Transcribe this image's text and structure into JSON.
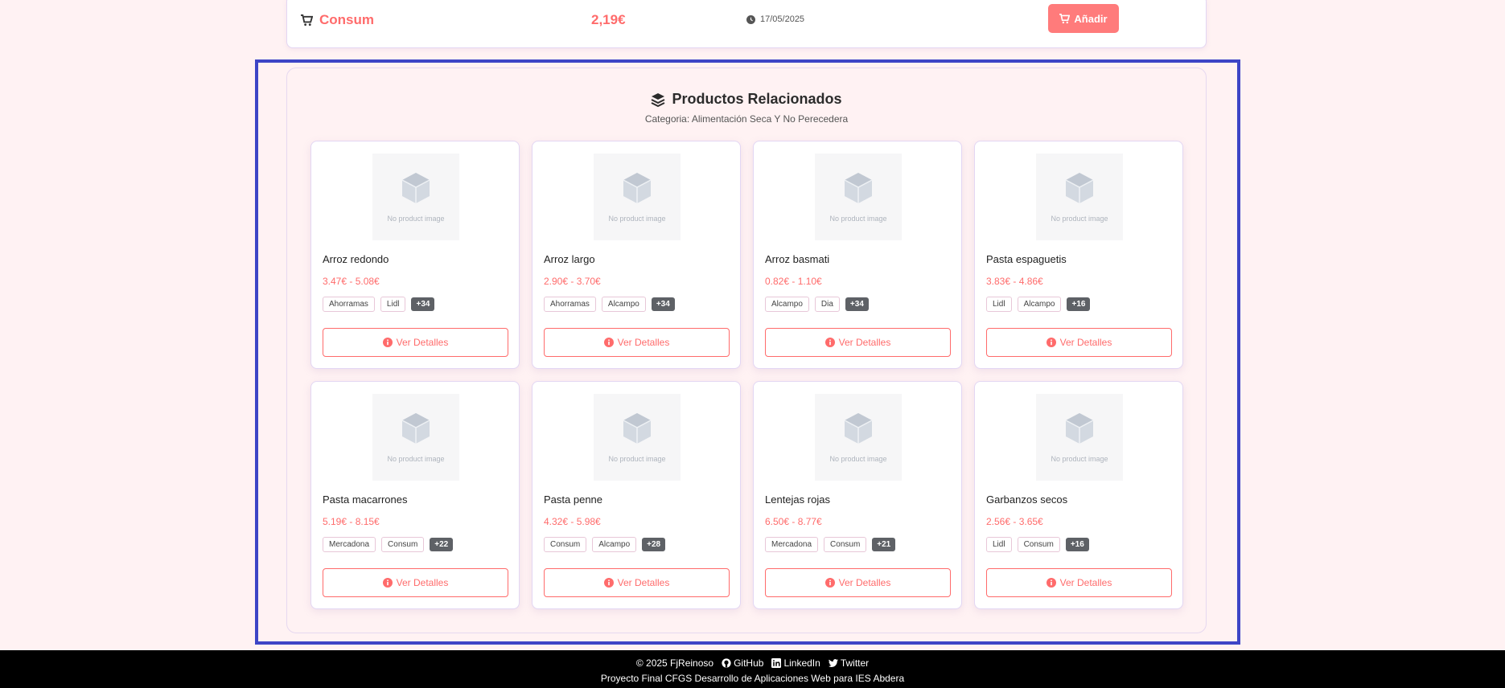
{
  "store_row": {
    "store": "Consum",
    "price": "2,19€",
    "date": "17/05/2025",
    "add_label": "Añadir"
  },
  "related": {
    "title": "Productos Relacionados",
    "subtitle": "Categoria: Alimentación Seca Y No Perecedera",
    "no_image_text": "No product image",
    "detail_label": "Ver Detalles",
    "products": [
      {
        "name": "Arroz redondo",
        "price": "3.47€ - 5.08€",
        "tags": [
          "Ahorramas",
          "Lidl"
        ],
        "more": "+34"
      },
      {
        "name": "Arroz largo",
        "price": "2.90€ - 3.70€",
        "tags": [
          "Ahorramas",
          "Alcampo"
        ],
        "more": "+34"
      },
      {
        "name": "Arroz basmati",
        "price": "0.82€ - 1.10€",
        "tags": [
          "Alcampo",
          "Dia"
        ],
        "more": "+34"
      },
      {
        "name": "Pasta espaguetis",
        "price": "3.83€ - 4.86€",
        "tags": [
          "Lidl",
          "Alcampo"
        ],
        "more": "+16"
      },
      {
        "name": "Pasta macarrones",
        "price": "5.19€ - 8.15€",
        "tags": [
          "Mercadona",
          "Consum"
        ],
        "more": "+22"
      },
      {
        "name": "Pasta penne",
        "price": "4.32€ - 5.98€",
        "tags": [
          "Consum",
          "Alcampo"
        ],
        "more": "+28"
      },
      {
        "name": "Lentejas rojas",
        "price": "6.50€ - 8.77€",
        "tags": [
          "Mercadona",
          "Consum"
        ],
        "more": "+21"
      },
      {
        "name": "Garbanzos secos",
        "price": "2.56€ - 3.65€",
        "tags": [
          "Lidl",
          "Consum"
        ],
        "more": "+16"
      }
    ]
  },
  "footer": {
    "copyright": "© 2025 FjReinoso",
    "links": [
      "GitHub",
      "LinkedIn",
      "Twitter"
    ],
    "credit": "Proyecto Final CFGS Desarrollo de Aplicaciones Web para IES Abdera"
  },
  "colors": {
    "accent": "#ff6b6b",
    "highlight_frame": "#3d45c6",
    "background": "#fff2f3"
  }
}
